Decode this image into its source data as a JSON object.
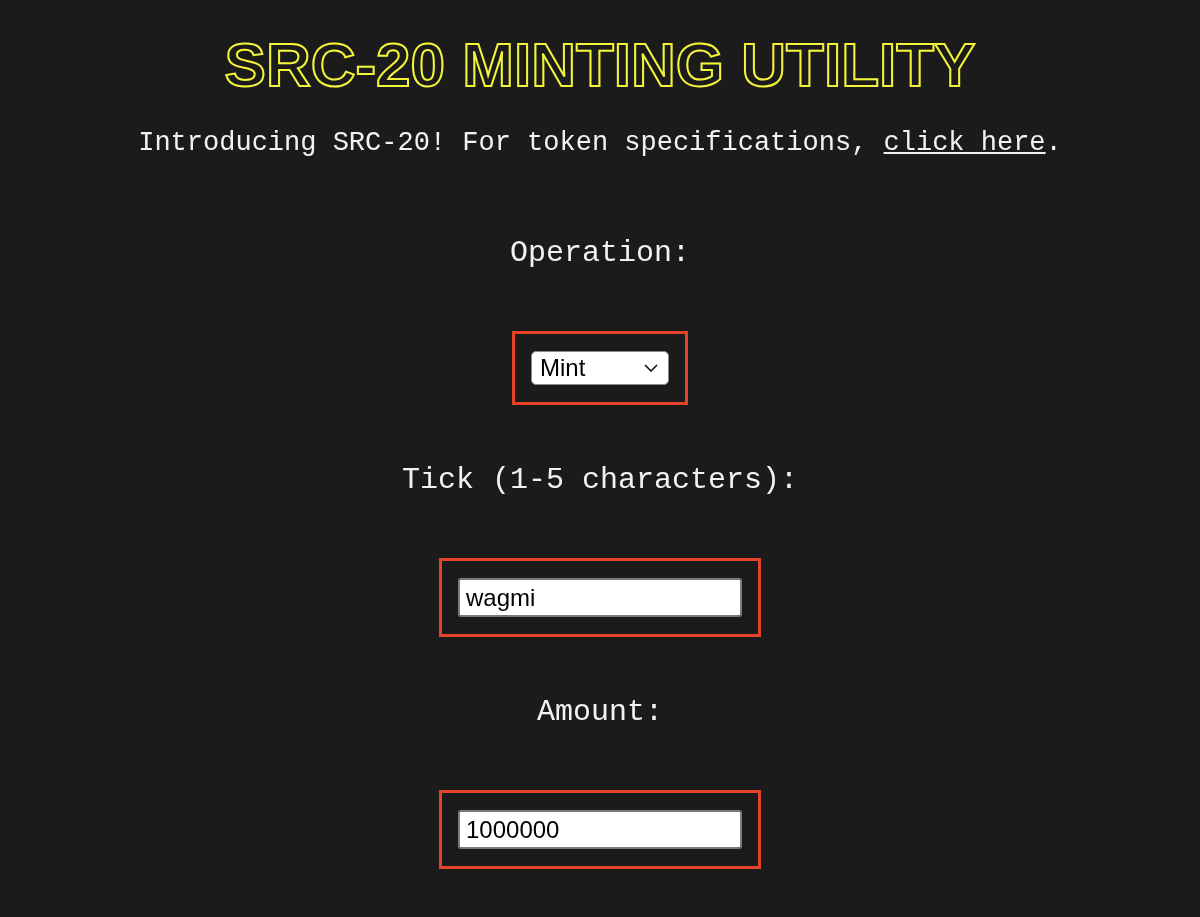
{
  "title": "SRC-20 MINTING UTILITY",
  "intro": {
    "text_before": "Introducing SRC-20! For token specifications, ",
    "link": "click here",
    "text_after": "."
  },
  "fields": [
    {
      "label": "Operation:",
      "kind": "select",
      "value": "Mint",
      "highlighted": true
    },
    {
      "label": "Tick (1-5 characters):",
      "kind": "text",
      "value": "wagmi",
      "highlighted": true
    },
    {
      "label": "Amount:",
      "kind": "text",
      "value": "1000000",
      "highlighted": true
    }
  ]
}
